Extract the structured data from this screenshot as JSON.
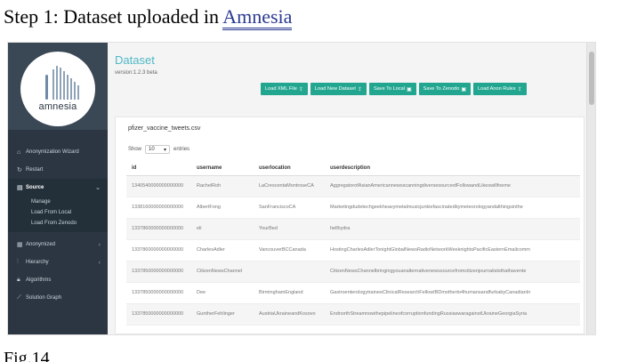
{
  "doc": {
    "heading_prefix": "Step 1: Dataset uploaded in ",
    "heading_link": "Amnesia",
    "caption": "Fig.14"
  },
  "logo": {
    "word": "amnesia"
  },
  "sidebar": {
    "items": [
      {
        "label": "Anonymization Wizard",
        "icon": "home-icon"
      },
      {
        "label": "Restart",
        "icon": "refresh-icon"
      },
      {
        "label": "Source",
        "icon": "file-icon",
        "active": true
      },
      {
        "label": "Anonymized",
        "icon": "database-icon"
      },
      {
        "label": "Hierarchy",
        "icon": "hierarchy-icon"
      },
      {
        "label": "Algorithms",
        "icon": "lock-icon"
      },
      {
        "label": "Solution Graph",
        "icon": "chart-icon"
      }
    ],
    "source_sub": [
      "Manage",
      "Load From Local",
      "Load From Zenodo"
    ]
  },
  "main": {
    "title": "Dataset",
    "version": "version:1.2.3 beta",
    "buttons": [
      "Load XML File",
      "Load New Dataset",
      "Save To Local",
      "Save To Zenodo",
      "Load Anon Rules"
    ]
  },
  "panel": {
    "file_name": "pfizer_vaccine_tweets.csv",
    "show_label": "Show",
    "show_value": "10",
    "entries_label": "entries",
    "columns": [
      "id",
      "username",
      "userlocation",
      "userdescription"
    ],
    "rows": [
      [
        "1340540000000000000",
        "RachelRoh",
        "LaCrescentaMontroseCA",
        "AggregatorofAsianAmericannewsscanningdiversesourcesfFollowandLikeswillfoeme"
      ],
      [
        "1338160000000000000",
        "AlbertFong",
        "SanFranciscoCA",
        "Marketingdudetechgeekheavymetalmusicjunkiefascinatedbymeteorologyandalthingsinthe"
      ],
      [
        "1337860000000000000",
        "eli",
        "YourBed",
        "hellhydra"
      ],
      [
        "1337860000000000000",
        "CharlesAdler",
        "VancouverBCCanada",
        "HostingCharlesAdlerTonightGlobalNewsRadioNetworkWeeknightsPacificEasternEmailcomm"
      ],
      [
        "1337850000000000000",
        "CitizenNewsChannel",
        "",
        "CitizenNewsChannelbringingyouanalternativenewssourcefromcitizenjournaliststhathavente"
      ],
      [
        "1337850000000000000",
        "Dee",
        "BirminghamEngland",
        "GastroenterologytraineeClinicalResearchFellowIBDmotherto4humansandfurbabyCanadianIn"
      ],
      [
        "1337850000000000000",
        "GuntherFehlinger",
        "AustriaUkraineandKosovo",
        "EndnorthStreamnowthepipelineofcorruptionfundingRussiaswaragainstUkraineGeorgiaSyria"
      ]
    ]
  }
}
